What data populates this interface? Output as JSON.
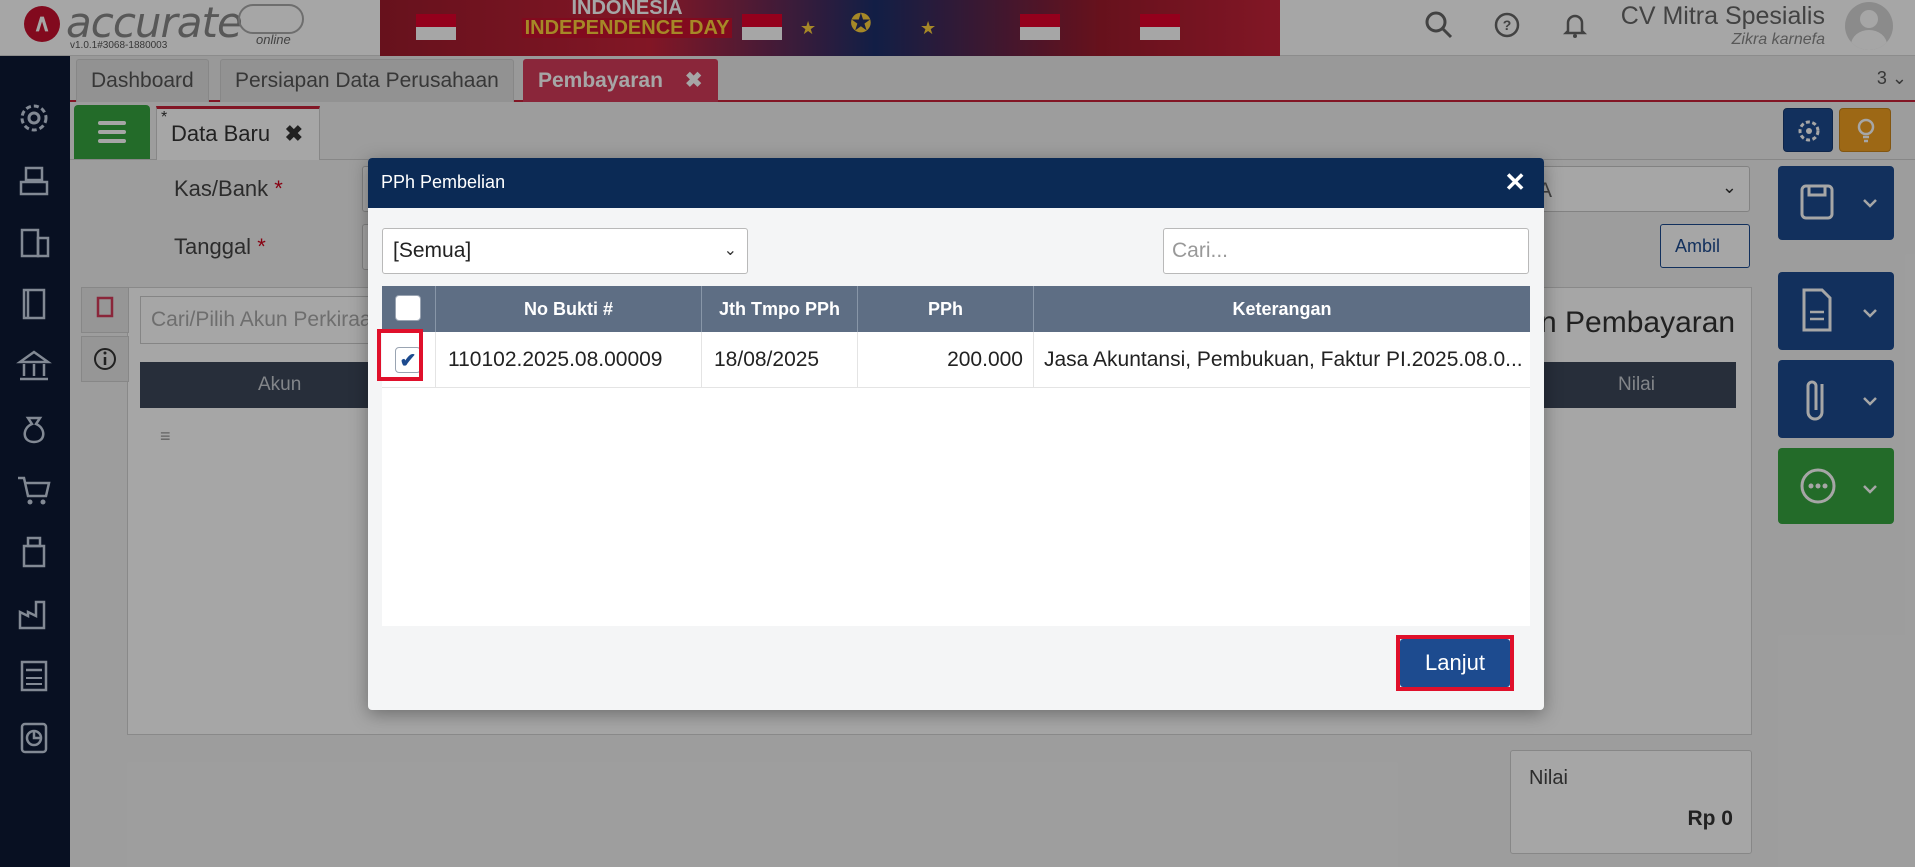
{
  "app": {
    "logo_text": "accurate",
    "logo_sub": "online",
    "version": "v1.0.1#3068-1880003",
    "banner_line1": "INDONESIA",
    "banner_line2": "INDEPENDENCE DAY",
    "company_name": "CV Mitra Spesialis",
    "user_name": "Zikra karnefa"
  },
  "header_icons": [
    "search-icon",
    "help-icon",
    "bell-icon"
  ],
  "sidebar": {
    "icons": [
      "settings-icon",
      "cash-register-icon",
      "building-icon",
      "ledger-book-icon",
      "bank-icon",
      "money-bag-icon",
      "cart-icon",
      "inventory-icon",
      "factory-icon",
      "tax-calculator-icon",
      "report-chart-icon"
    ]
  },
  "tabs": [
    {
      "label": "Dashboard"
    },
    {
      "label": "Persiapan Data Perusahaan"
    },
    {
      "label": "Pembayaran",
      "close": "✖"
    }
  ],
  "tab_count": "3",
  "subtab": {
    "star": "*",
    "label": "Data Baru",
    "close": "✖"
  },
  "form": {
    "kas_bank_label": "Kas/Bank",
    "tanggal_label": "Tanggal",
    "required_mark": "*",
    "kas_bank_value_fragment": "A",
    "ambil_label": "Ambil",
    "search_placeholder": "Cari/Pilih Akun Perkiraan",
    "col_akun": "Akun",
    "col_nilai": "Nilai",
    "section_title": "n Pembayaran",
    "nilai_label": "Nilai",
    "nilai_value": "Rp 0"
  },
  "modal": {
    "title": "PPh Pembelian",
    "close": "✕",
    "filter_value": "[Semua]",
    "search_placeholder": "Cari...",
    "columns": [
      "No Bukti #",
      "Jth Tmpo PPh",
      "PPh",
      "Keterangan"
    ],
    "rows": [
      {
        "checked": true,
        "no_bukti": "110102.2025.08.00009",
        "jth_tmpo": "18/08/2025",
        "pph": "200.000",
        "keterangan": "Jasa Akuntansi, Pembukuan, Faktur PI.2025.08.0..."
      }
    ],
    "lanjut_label": "Lanjut"
  },
  "colors": {
    "primary": "#1d4b8f",
    "header_dark": "#0b2a55",
    "accent_red": "#c8233a",
    "highlight": "#e0102b",
    "green": "#37a540",
    "amber": "#f1a021"
  }
}
